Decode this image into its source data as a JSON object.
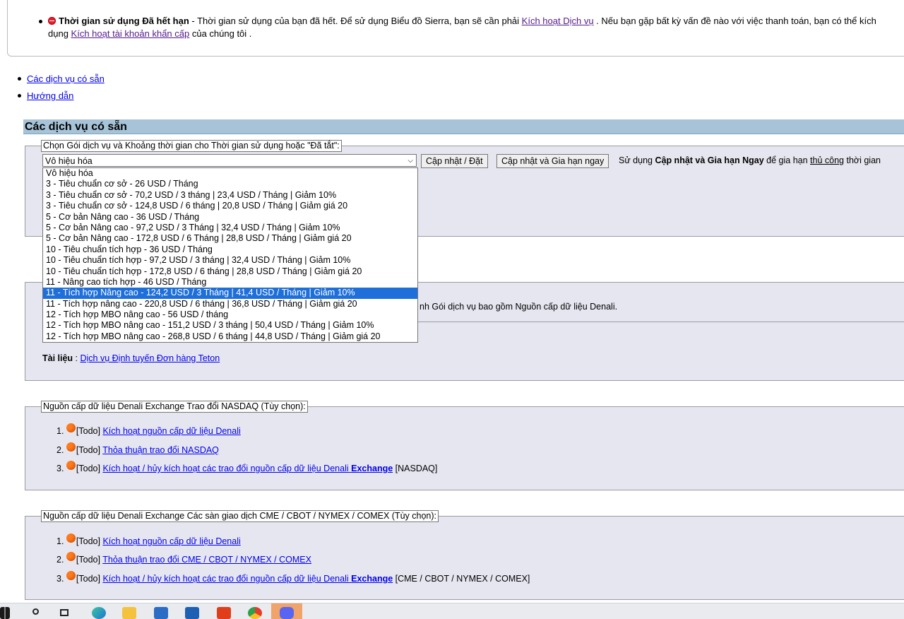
{
  "notice": {
    "title": "Thời gian sử dụng Đã hết hạn",
    "text1": " - Thời gian sử dụng của bạn đã hết. Để sử dụng Biểu đồ Sierra, bạn sẽ cần phải ",
    "link1": "Kích hoạt Dịch vụ",
    "text2": " . Nếu bạn gặp bất kỳ vấn đề nào với việc thanh toán, bạn có thể kích",
    "text3": "dụng ",
    "link2": "Kích hoạt tài khoản khẩn cấp",
    "text4": " của chúng tôi ."
  },
  "toplinks": [
    "Các dịch vụ có sẵn",
    "Hướng dẫn"
  ],
  "section_title": "Các dịch vụ có sẵn",
  "package_panel": {
    "legend": "Chọn Gói dịch vụ và Khoảng thời gian cho Thời gian sử dụng hoặc \"Đã tắt\":",
    "select_value": "Vô hiệu hóa",
    "btn_update": "Cập nhật / Đặt",
    "btn_update_extend": "Cập nhật và Gia hạn ngay",
    "hint_prefix": "Sử dụng ",
    "hint_bold": "Cập nhật và Gia hạn Ngay",
    "hint_mid": " để gia hạn ",
    "hint_link": "thủ công",
    "hint_suffix": " thời gian"
  },
  "dropdown_options": [
    "Vô hiệu hóa",
    "3 - Tiêu chuẩn cơ sở - 26 USD / Tháng",
    "3 - Tiêu chuẩn cơ sở - 70,2 USD / 3 tháng | 23,4 USD / Tháng | Giảm 10%",
    "3 - Tiêu chuẩn cơ sở - 124,8 USD / 6 tháng | 20,8 USD / Tháng | Giảm giá 20",
    "5 - Cơ bản Nâng cao - 36 USD / Tháng",
    "5 - Cơ bản Nâng cao - 97,2 USD / 3 Tháng | 32,4 USD / Tháng | Giảm 10%",
    "5 - Cơ bản Nâng cao - 172,8 USD / 6 Tháng | 28,8 USD / Tháng | Giảm giá 20",
    "10 - Tiêu chuẩn tích hợp - 36 USD / Tháng",
    "10 - Tiêu chuẩn tích hợp - 97,2 USD / 3 tháng | 32,4 USD / Tháng | Giảm 10%",
    "10 - Tiêu chuẩn tích hợp - 172,8 USD / 6 tháng | 28,8 USD / Tháng | Giảm giá 20",
    "11 - Nâng cao tích hợp - 46 USD / Tháng",
    "11 - Tích hợp Nâng cao - 124,2 USD / 3 Tháng | 41,4 USD / Tháng | Giảm 10%",
    "11 - Tích hợp nâng cao - 220,8 USD / 6 tháng | 36,8 USD / Tháng | Giảm giá 20",
    "12 - Tích hợp MBO nâng cao - 56 USD / tháng",
    "12 - Tích hợp MBO nâng cao - 151,2 USD / 3 tháng | 50,4 USD / Tháng | Giảm 10%",
    "12 - Tích hợp MBO nâng cao - 268,8 USD / 6 tháng | 44,8 USD / Tháng | Giảm giá 20"
  ],
  "dropdown_selected_index": 11,
  "teton_panel": {
    "partial_text": "nh Gói dịch vụ bao gồm Nguồn cấp dữ liệu Denali.",
    "doc_label": "Tài liệu",
    "doc_sep": " : ",
    "doc_link": "Dịch vụ Định tuyến Đơn hàng Teton"
  },
  "nasdaq_panel": {
    "legend": "Nguồn cấp dữ liệu Denali Exchange Trao đổi NASDAQ (Tùy chọn):",
    "items": [
      {
        "num": "1.",
        "tag": "[Todo] ",
        "link": "Kích hoạt nguồn cấp dữ liệu Denali",
        "bold": "",
        "suffix": ""
      },
      {
        "num": "2.",
        "tag": "[Todo] ",
        "link": "Thỏa thuận trao đổi NASDAQ",
        "bold": "",
        "suffix": ""
      },
      {
        "num": "3.",
        "tag": "[Todo] ",
        "link": "Kích hoạt / hủy kích hoạt các trao đổi nguồn cấp dữ liệu Denali ",
        "bold": "Exchange",
        "suffix": " [NASDAQ]"
      }
    ]
  },
  "cme_panel": {
    "legend": "Nguồn cấp dữ liệu Denali Exchange Các sàn giao dịch CME / CBOT / NYMEX / COMEX (Tùy chọn):",
    "items": [
      {
        "num": "1.",
        "tag": "[Todo] ",
        "link": "Kích hoạt nguồn cấp dữ liệu Denali",
        "bold": "",
        "suffix": ""
      },
      {
        "num": "2.",
        "tag": "[Todo] ",
        "link": "Thỏa thuận trao đổi CME / CBOT / NYMEX / COMEX",
        "bold": "",
        "suffix": ""
      },
      {
        "num": "3.",
        "tag": "[Todo] ",
        "link": "Kích hoạt / hủy kích hoạt các trao đổi nguồn cấp dữ liệu Denali ",
        "bold": "Exchange",
        "suffix": " [CME / CBOT / NYMEX / COMEX]"
      }
    ]
  },
  "taskbar_icons": [
    "windows-start-icon",
    "search-icon",
    "task-view-icon",
    "edge-icon",
    "file-explorer-icon",
    "store-icon",
    "mail-icon",
    "office-icon",
    "chrome-icon",
    "discord-icon"
  ]
}
